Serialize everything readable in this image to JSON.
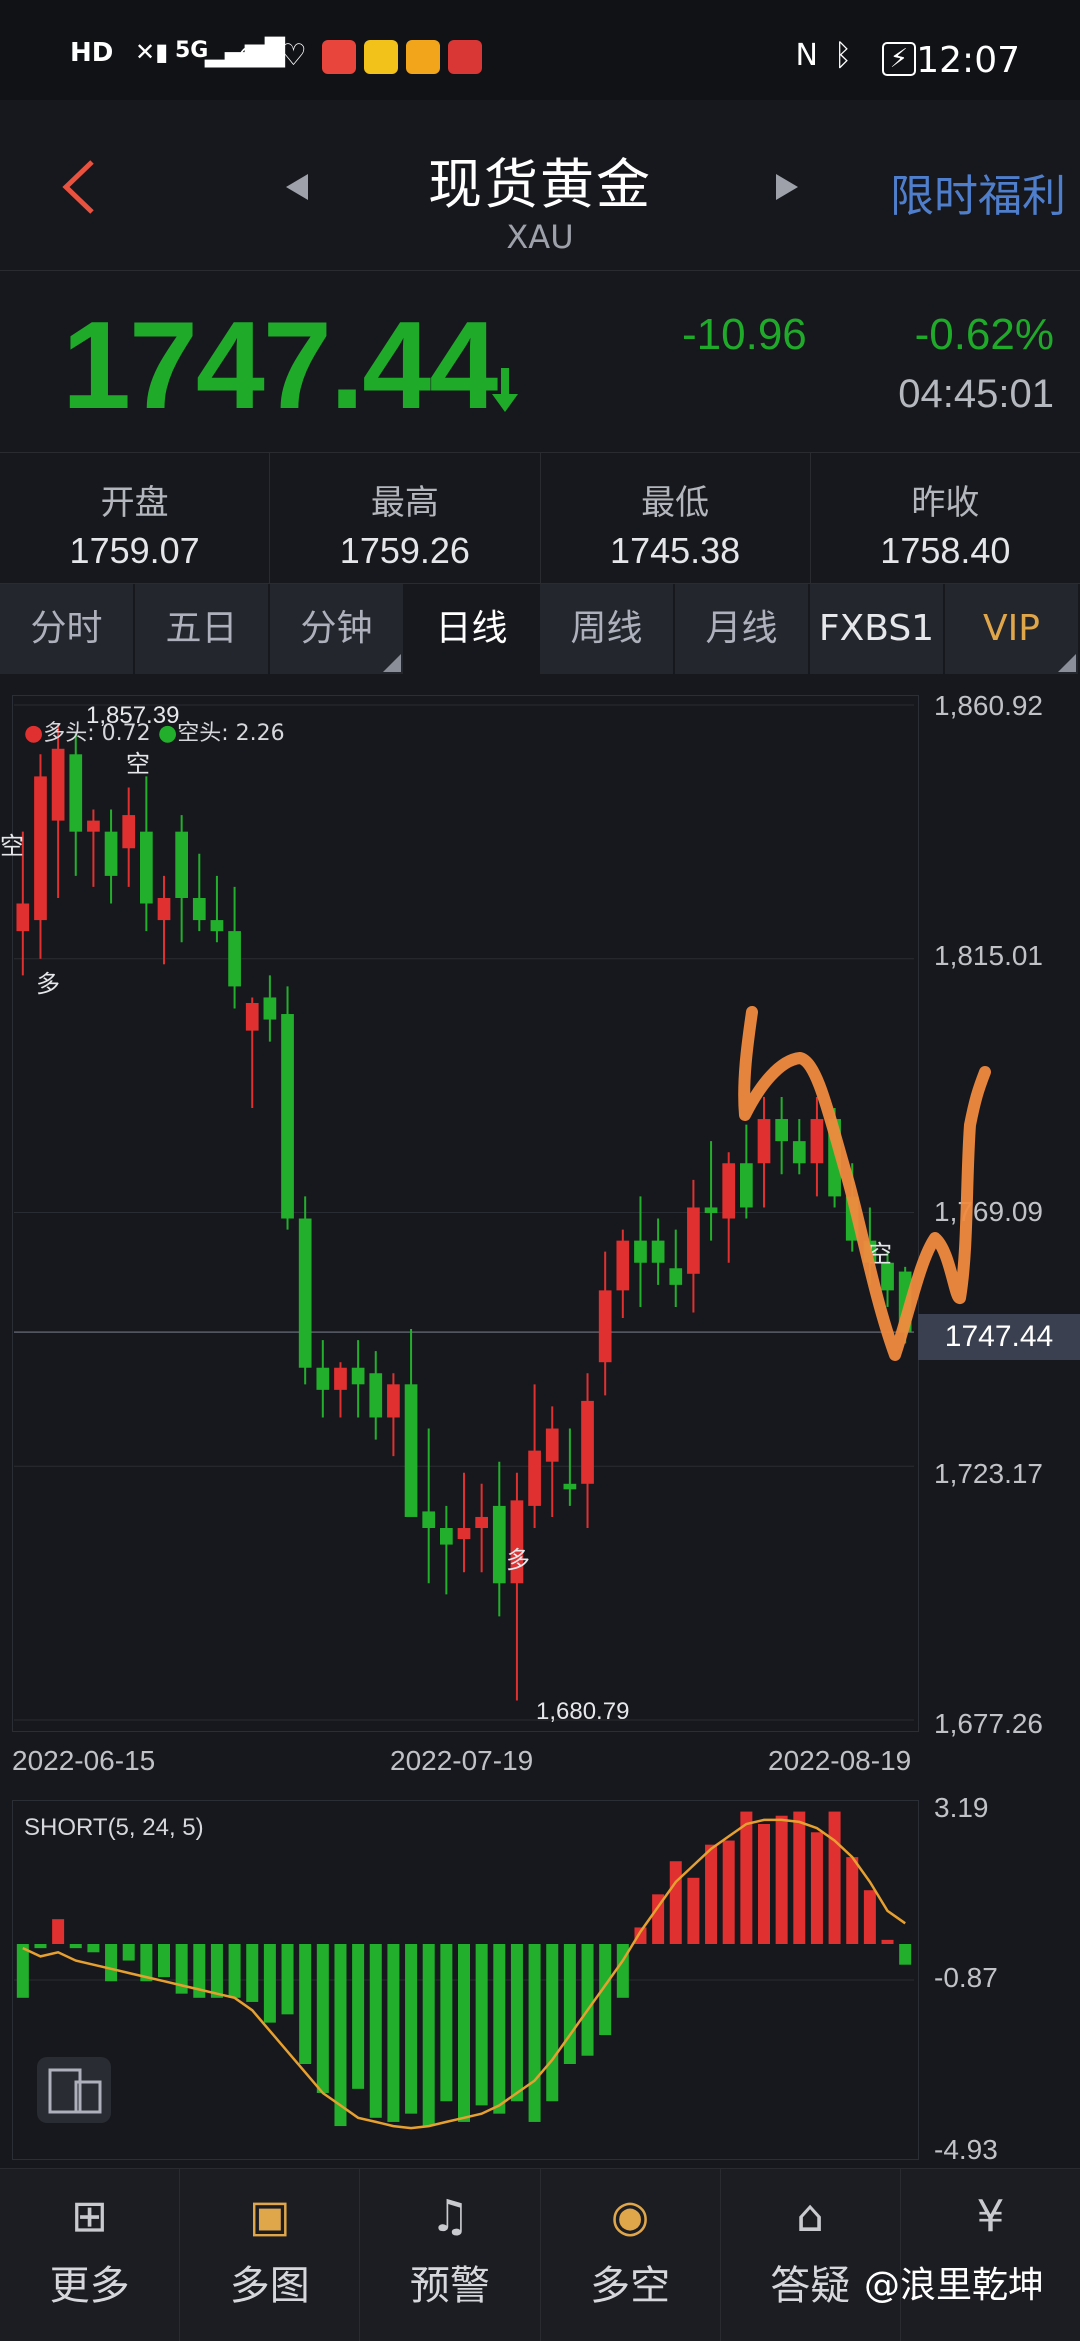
{
  "status_bar": {
    "left_icons": [
      "HD2",
      "no-signal",
      "5G",
      "wifi",
      "heart-monitor",
      "app-red",
      "weibo",
      "weibo",
      "app-heart"
    ],
    "hd": "HD",
    "net": "5G",
    "time": "12:07"
  },
  "header": {
    "back_icon": "chevron-left-icon",
    "title": "现货黄金",
    "subtitle": "XAU",
    "promo": "限时福利"
  },
  "quote": {
    "price": "1747.44",
    "change": "-10.96",
    "change_pct": "-0.62%",
    "time": "04:45:01",
    "color": "#1faa2a"
  },
  "stats": [
    {
      "label": "开盘",
      "value": "1759.07"
    },
    {
      "label": "最高",
      "value": "1759.26"
    },
    {
      "label": "最低",
      "value": "1745.38"
    },
    {
      "label": "昨收",
      "value": "1758.40"
    }
  ],
  "tabs": [
    "分时",
    "五日",
    "分钟",
    "日线",
    "周线",
    "月线",
    "FXBS1",
    "VIP"
  ],
  "active_tab": "日线",
  "chart": {
    "legend_long": "多头: 0.72",
    "legend_short": "空头: 2.26",
    "high_label": "1,857.39",
    "low_label": "1,680.79",
    "y_ticks": [
      "1,860.92",
      "1,815.01",
      "1,769.09",
      "1,723.17",
      "1,677.26"
    ],
    "x_ticks": [
      "2022-06-15",
      "2022-07-19",
      "2022-08-19"
    ],
    "current": "1747.44",
    "marker_long": "多",
    "marker_short": "空",
    "up_color": "#e03030",
    "down_color": "#22b02c"
  },
  "chart_data": [
    {
      "type": "candlestick",
      "title": "",
      "ylim": [
        1677.26,
        1860.92
      ],
      "x_range": [
        "2022-06-15",
        "2022-08-19"
      ],
      "candles": [
        {
          "o": 1820,
          "h": 1838,
          "l": 1812,
          "c": 1825
        },
        {
          "o": 1822,
          "h": 1852,
          "l": 1815,
          "c": 1848
        },
        {
          "o": 1840,
          "h": 1857.39,
          "l": 1826,
          "c": 1853
        },
        {
          "o": 1852,
          "h": 1856,
          "l": 1830,
          "c": 1838
        },
        {
          "o": 1838,
          "h": 1842,
          "l": 1828,
          "c": 1840
        },
        {
          "o": 1838,
          "h": 1842,
          "l": 1825,
          "c": 1830
        },
        {
          "o": 1835,
          "h": 1846,
          "l": 1828,
          "c": 1841
        },
        {
          "o": 1838,
          "h": 1848,
          "l": 1820,
          "c": 1825
        },
        {
          "o": 1822,
          "h": 1830,
          "l": 1814,
          "c": 1826
        },
        {
          "o": 1838,
          "h": 1841,
          "l": 1818,
          "c": 1826
        },
        {
          "o": 1826,
          "h": 1834,
          "l": 1820,
          "c": 1822
        },
        {
          "o": 1822,
          "h": 1830,
          "l": 1818,
          "c": 1820
        },
        {
          "o": 1820,
          "h": 1828,
          "l": 1806,
          "c": 1810
        },
        {
          "o": 1802,
          "h": 1808,
          "l": 1788,
          "c": 1807
        },
        {
          "o": 1808,
          "h": 1812,
          "l": 1800,
          "c": 1804
        },
        {
          "o": 1805,
          "h": 1810,
          "l": 1766,
          "c": 1768
        },
        {
          "o": 1768,
          "h": 1772,
          "l": 1738,
          "c": 1741
        },
        {
          "o": 1741,
          "h": 1746,
          "l": 1732,
          "c": 1737
        },
        {
          "o": 1737,
          "h": 1742,
          "l": 1732,
          "c": 1741
        },
        {
          "o": 1741,
          "h": 1746,
          "l": 1732,
          "c": 1738
        },
        {
          "o": 1740,
          "h": 1744,
          "l": 1728,
          "c": 1732
        },
        {
          "o": 1732,
          "h": 1740,
          "l": 1725,
          "c": 1738
        },
        {
          "o": 1738,
          "h": 1748,
          "l": 1720,
          "c": 1714
        },
        {
          "o": 1715,
          "h": 1730,
          "l": 1702,
          "c": 1712
        },
        {
          "o": 1712,
          "h": 1716,
          "l": 1700,
          "c": 1709
        },
        {
          "o": 1710,
          "h": 1722,
          "l": 1704,
          "c": 1712
        },
        {
          "o": 1712,
          "h": 1720,
          "l": 1704,
          "c": 1714
        },
        {
          "o": 1716,
          "h": 1724,
          "l": 1696,
          "c": 1702
        },
        {
          "o": 1702,
          "h": 1722,
          "l": 1680.79,
          "c": 1717
        },
        {
          "o": 1716,
          "h": 1738,
          "l": 1712,
          "c": 1726
        },
        {
          "o": 1724,
          "h": 1734,
          "l": 1714,
          "c": 1730
        },
        {
          "o": 1720,
          "h": 1730,
          "l": 1716,
          "c": 1719
        },
        {
          "o": 1720,
          "h": 1740,
          "l": 1712,
          "c": 1735
        },
        {
          "o": 1742,
          "h": 1762,
          "l": 1736,
          "c": 1755
        },
        {
          "o": 1755,
          "h": 1766,
          "l": 1750,
          "c": 1764
        },
        {
          "o": 1764,
          "h": 1772,
          "l": 1752,
          "c": 1760
        },
        {
          "o": 1764,
          "h": 1768,
          "l": 1756,
          "c": 1760
        },
        {
          "o": 1759,
          "h": 1766,
          "l": 1752,
          "c": 1756
        },
        {
          "o": 1758,
          "h": 1775,
          "l": 1751,
          "c": 1770
        },
        {
          "o": 1770,
          "h": 1782,
          "l": 1764,
          "c": 1769
        },
        {
          "o": 1768,
          "h": 1780,
          "l": 1760,
          "c": 1778
        },
        {
          "o": 1778,
          "h": 1785,
          "l": 1768,
          "c": 1770
        },
        {
          "o": 1778,
          "h": 1790,
          "l": 1770,
          "c": 1786
        },
        {
          "o": 1786,
          "h": 1790,
          "l": 1776,
          "c": 1782
        },
        {
          "o": 1782,
          "h": 1786,
          "l": 1776,
          "c": 1778
        },
        {
          "o": 1778,
          "h": 1790,
          "l": 1772,
          "c": 1786
        },
        {
          "o": 1786,
          "h": 1788,
          "l": 1770,
          "c": 1772
        },
        {
          "o": 1772,
          "h": 1778,
          "l": 1762,
          "c": 1764
        },
        {
          "o": 1764,
          "h": 1770,
          "l": 1756,
          "c": 1760
        },
        {
          "o": 1760,
          "h": 1762,
          "l": 1752,
          "c": 1755
        },
        {
          "o": 1758.4,
          "h": 1759.26,
          "l": 1745.38,
          "c": 1747.44
        }
      ]
    },
    {
      "type": "bar",
      "title": "SHORT(5, 24, 5)",
      "ylim": [
        -4.93,
        3.19
      ],
      "y_ticks": [
        "3.19",
        "-0.87",
        "-4.93"
      ],
      "series": [
        {
          "name": "SHORT",
          "values": [
            -1.3,
            -0.1,
            0.6,
            -0.1,
            -0.2,
            -0.9,
            -0.4,
            -0.9,
            -0.8,
            -1.2,
            -1.3,
            -1.3,
            -1.3,
            -1.4,
            -1.9,
            -1.7,
            -2.9,
            -3.6,
            -4.4,
            -3.5,
            -4.2,
            -4.3,
            -4.1,
            -4.4,
            -3.8,
            -4.3,
            -3.9,
            -4.1,
            -3.8,
            -4.3,
            -3.8,
            -2.9,
            -2.7,
            -2.2,
            -1.3,
            0.4,
            1.2,
            2.0,
            1.6,
            2.4,
            2.5,
            3.2,
            2.9,
            3.1,
            3.2,
            2.7,
            3.2,
            2.1,
            1.3,
            0.1,
            -0.5
          ]
        },
        {
          "name": "",
          "values": [
            -0.1,
            -0.3,
            -0.2,
            -0.4,
            -0.5,
            -0.6,
            -0.7,
            -0.8,
            -0.9,
            -1.0,
            -1.1,
            -1.2,
            -1.3,
            -1.6,
            -2.1,
            -2.6,
            -3.1,
            -3.6,
            -3.9,
            -4.2,
            -4.3,
            -4.4,
            -4.45,
            -4.4,
            -4.3,
            -4.2,
            -4.1,
            -3.9,
            -3.6,
            -3.3,
            -2.8,
            -2.2,
            -1.6,
            -1.0,
            -0.4,
            0.3,
            0.9,
            1.5,
            1.9,
            2.3,
            2.6,
            2.9,
            3.0,
            3.0,
            2.95,
            2.8,
            2.5,
            2.1,
            1.5,
            0.8,
            0.5
          ]
        }
      ]
    }
  ],
  "nav": [
    {
      "label": "更多",
      "icon": "grid-icon"
    },
    {
      "label": "多图",
      "icon": "chart-icon"
    },
    {
      "label": "预警",
      "icon": "bell-icon"
    },
    {
      "label": "多空",
      "icon": "trend-icon"
    },
    {
      "label": "答疑",
      "icon": "graduation-icon"
    },
    {
      "label": "",
      "icon": "moneybag-icon"
    }
  ],
  "watermark": "@浪里乾坤"
}
